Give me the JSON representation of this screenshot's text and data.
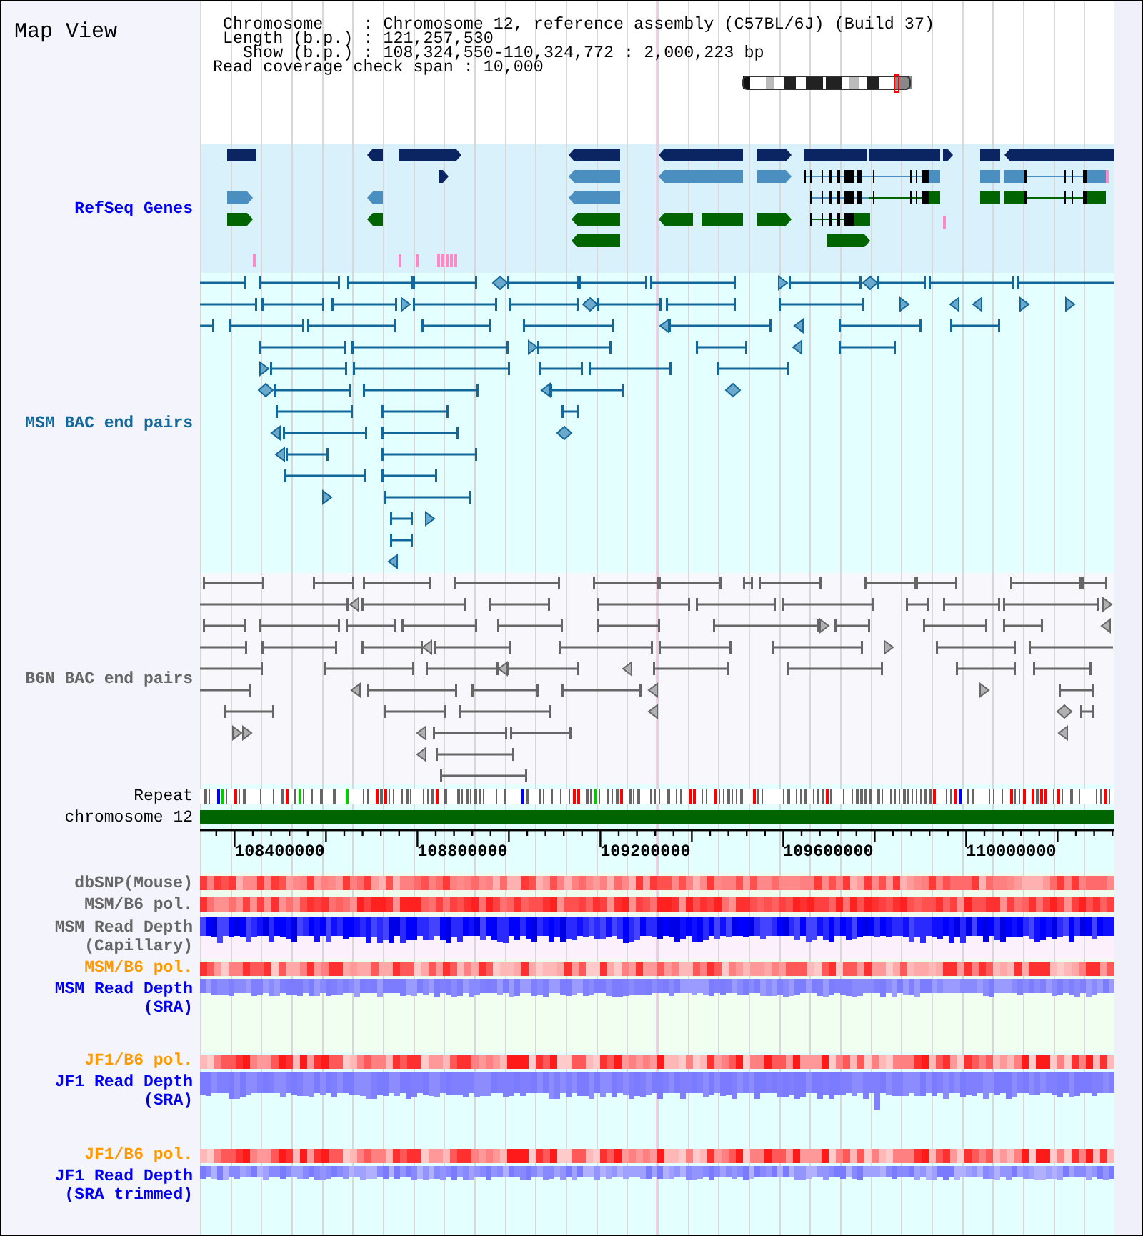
{
  "panel": {
    "title": "Map View"
  },
  "info": {
    "lines": [
      "Chromosome    : Chromosome 12, reference assembly (C57BL/6J) (Build 37)",
      "Length (b.p.) : 121,257,530",
      "Show (b.p.) : 108,324,550-110,324,772 : 2,000,223 bp",
      "Read coverage check span : 10,000"
    ]
  },
  "tracks": [
    {
      "kind": "genes",
      "label_lines": [
        "RefSeq Genes"
      ],
      "color": "#0000ee"
    },
    {
      "kind": "bac",
      "label_lines": [
        "MSM BAC end pairs"
      ],
      "color": "#13679a"
    },
    {
      "kind": "bac",
      "label_lines": [
        "B6N BAC end pairs"
      ],
      "color": "#666666"
    },
    {
      "kind": "repeat",
      "label_lines": [
        "Repeat"
      ],
      "color": "#000000"
    },
    {
      "kind": "chromosome",
      "label_lines": [
        "chromosome 12"
      ],
      "color": "#000000"
    },
    {
      "kind": "axis",
      "labels": [
        "108400000",
        "108800000",
        "109200000",
        "109600000",
        "110000000"
      ]
    },
    {
      "kind": "heat",
      "label_lines": [
        "dbSNP(Mouse)"
      ],
      "color": "#666666"
    },
    {
      "kind": "heat",
      "label_lines": [
        "MSM/B6 pol."
      ],
      "color": "#666666"
    },
    {
      "kind": "depth",
      "label_lines": [
        "MSM Read Depth",
        "(Capillary)"
      ],
      "color": "#666666"
    },
    {
      "kind": "heat",
      "label_lines": [
        "MSM/B6 pol."
      ],
      "color": "#ff9900"
    },
    {
      "kind": "depth",
      "label_lines": [
        "MSM Read Depth",
        "(SRA)"
      ],
      "color": "#0000ee"
    },
    {
      "kind": "heat",
      "label_lines": [
        "JF1/B6 pol."
      ],
      "color": "#ff9900"
    },
    {
      "kind": "depth",
      "label_lines": [
        "JF1 Read Depth",
        "(SRA)"
      ],
      "color": "#0000ee"
    },
    {
      "kind": "heat",
      "label_lines": [
        "JF1/B6 pol."
      ],
      "color": "#ff9900"
    },
    {
      "kind": "depth",
      "label_lines": [
        "JF1 Read Depth",
        "(SRA trimmed)"
      ],
      "color": "#0000ee"
    }
  ]
}
